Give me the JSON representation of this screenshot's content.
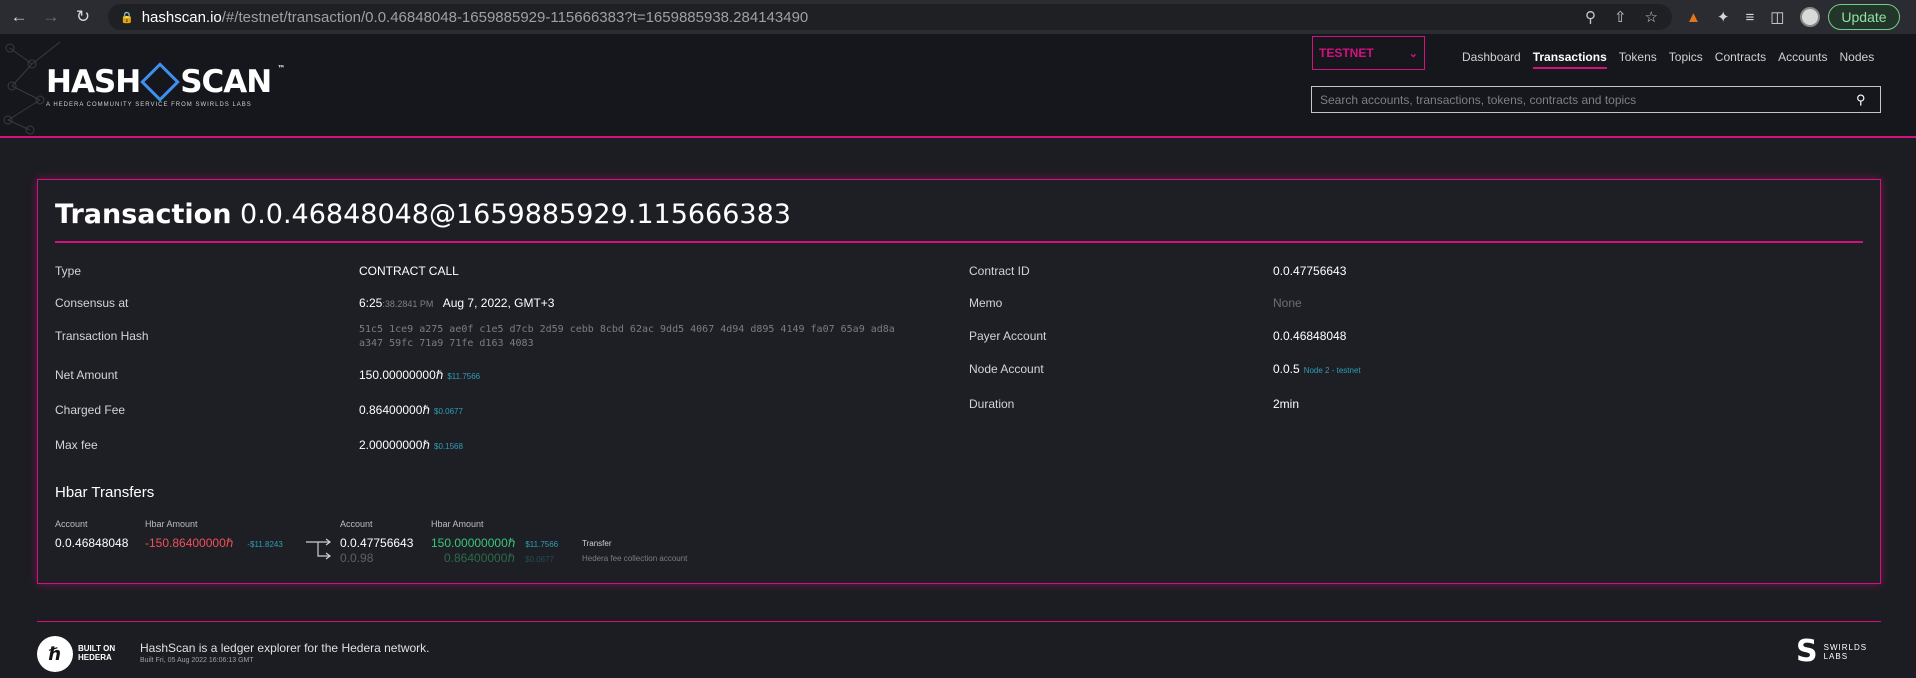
{
  "browser": {
    "url_host": "hashscan.io",
    "url_path": "/#/testnet/transaction/0.0.46848048-1659885929-115666383?t=1659885938.284143490",
    "update_label": "Update"
  },
  "header": {
    "logo_text_left": "HASH",
    "logo_text_right": "SCAN",
    "logo_tm": "™",
    "logo_tagline": "A HEDERA COMMUNITY SERVICE FROM SWIRLDS LABS",
    "network": "TESTNET",
    "nav": [
      "Dashboard",
      "Transactions",
      "Tokens",
      "Topics",
      "Contracts",
      "Accounts",
      "Nodes"
    ],
    "active_nav": "Transactions",
    "search_placeholder": "Search accounts, transactions, tokens, contracts and topics"
  },
  "transaction": {
    "title_label": "Transaction",
    "title_id": "0.0.46848048@1659885929.115666383",
    "type_label": "Type",
    "type_value": "CONTRACT CALL",
    "consensus_label": "Consensus at",
    "consensus_time": "6:25",
    "consensus_seconds": ":38.2841 PM",
    "consensus_date": "Aug 7, 2022, GMT+3",
    "hash_label": "Transaction Hash",
    "hash_line1": "51c5 1ce9 a275 ae0f c1e5 d7cb 2d59 cebb 8cbd 62ac 9dd5 4067 4d94 d895 4149 fa07 65a9 ad8a",
    "hash_line2": "a347 59fc 71a9 71fe d163 4083",
    "net_amount_label": "Net Amount",
    "net_amount_value": "150.00000000ℏ",
    "net_amount_usd": "$11.7566",
    "charged_fee_label": "Charged Fee",
    "charged_fee_value": "0.86400000ℏ",
    "charged_fee_usd": "$0.0677",
    "max_fee_label": "Max fee",
    "max_fee_value": "2.00000000ℏ",
    "max_fee_usd": "$0.1568",
    "contract_id_label": "Contract ID",
    "contract_id_value": "0.0.47756643",
    "memo_label": "Memo",
    "memo_value": "None",
    "payer_label": "Payer Account",
    "payer_value": "0.0.46848048",
    "node_label": "Node Account",
    "node_value": "0.0.5",
    "node_name": "Node 2 - testnet",
    "duration_label": "Duration",
    "duration_value": "2min"
  },
  "hbar_transfers": {
    "title": "Hbar Transfers",
    "col_account": "Account",
    "col_amount": "Hbar Amount",
    "from_account": "0.0.46848048",
    "from_amount": "-150.86400000ℏ",
    "from_usd": "-$11.8243",
    "to": [
      {
        "account": "0.0.47756643",
        "amount": "150.00000000ℏ",
        "usd": "$11.7566",
        "note": "Transfer"
      },
      {
        "account": "0.0.98",
        "amount": "0.86400000ℏ",
        "usd": "$0.0677",
        "note": "Hedera fee collection account"
      }
    ]
  },
  "footer": {
    "built_on_line1": "BUILT ON",
    "built_on_line2": "HEDERA",
    "description": "HashScan is a ledger explorer for the Hedera network.",
    "build_info": "Built Fri, 05 Aug 2022 16:06:13 GMT",
    "swirlds_line1": "SWIRLDS",
    "swirlds_line2": "LABS"
  },
  "colors": {
    "accent": "#d4117f",
    "usd": "#2e9fb4",
    "negative": "#f0505a",
    "positive": "#39c67a"
  }
}
